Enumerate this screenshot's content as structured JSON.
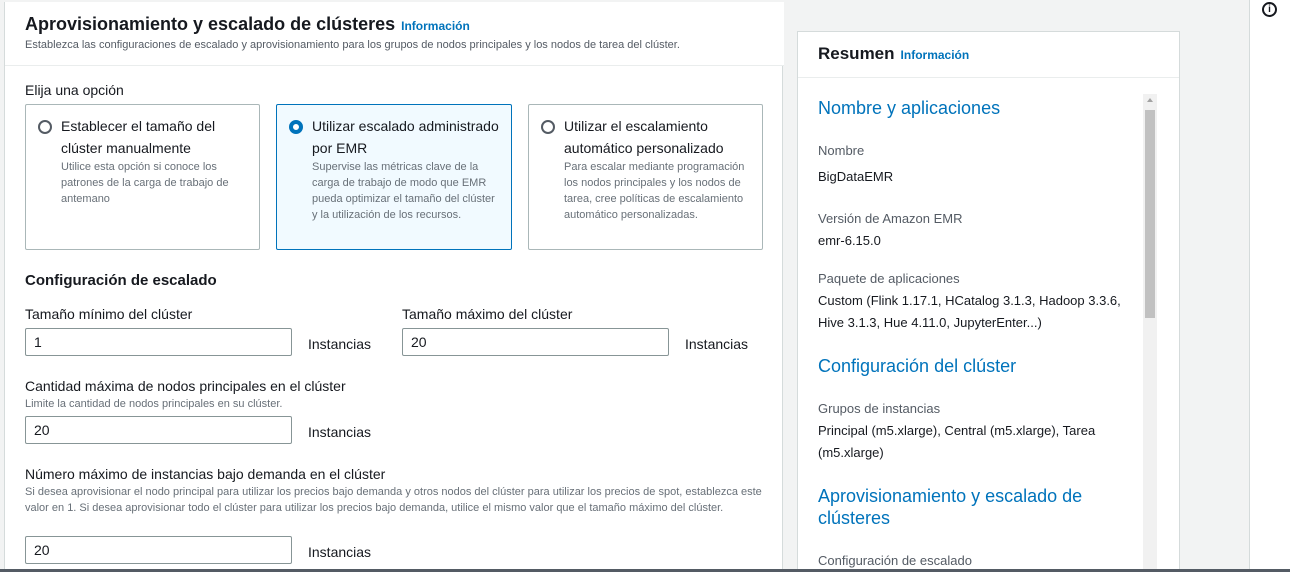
{
  "main": {
    "title": "Aprovisionamiento y escalado de clústeres",
    "info_link": "Información",
    "subtitle": "Establezca las configuraciones de escalado y aprovisionamiento para los grupos de nodos principales y los nodos de tarea del clúster.",
    "choose_label": "Elija una opción",
    "options": [
      {
        "title": "Establecer el tamaño del clúster manualmente",
        "desc": "Utilice esta opción si conoce los patrones de la carga de trabajo de antemano",
        "selected": false
      },
      {
        "title": "Utilizar escalado administrado por EMR",
        "desc": "Supervise las métricas clave de la carga de trabajo de modo que EMR pueda optimizar el tamaño del clúster y la utilización de los recursos.",
        "selected": true
      },
      {
        "title": "Utilizar el escalamiento automático personalizado",
        "desc": "Para escalar mediante programación los nodos principales y los nodos de tarea, cree políticas de escalamiento automático personalizadas.",
        "selected": false
      }
    ],
    "scaling_heading": "Configuración de escalado",
    "min_size_label": "Tamaño mínimo del clúster",
    "min_size_value": "1",
    "max_size_label": "Tamaño máximo del clúster",
    "max_size_value": "20",
    "instances_unit": "Instancias",
    "max_core_label": "Cantidad máxima de nodos principales en el clúster",
    "max_core_desc": "Limite la cantidad de nodos principales en su clúster.",
    "max_core_value": "20",
    "max_ondemand_label": "Número máximo de instancias bajo demanda en el clúster",
    "max_ondemand_desc": "Si desea aprovisionar el nodo principal para utilizar los precios bajo demanda y otros nodos del clúster para utilizar los precios de spot, establezca este valor en 1. Si desea aprovisionar todo el clúster para utilizar los precios bajo demanda, utilice el mismo valor que el tamaño máximo del clúster.",
    "max_ondemand_value": "20"
  },
  "summary": {
    "title": "Resumen",
    "info_link": "Información",
    "section1_heading": "Nombre y aplicaciones",
    "name_key": "Nombre",
    "name_value": "BigDataEMR",
    "version_key": "Versión de Amazon EMR",
    "version_value": "emr-6.15.0",
    "package_key": "Paquete de aplicaciones",
    "package_value": "Custom (Flink 1.17.1, HCatalog 3.1.3, Hadoop 3.3.6, Hive 3.1.3, Hue 4.11.0, JupyterEnter...)",
    "section2_heading": "Configuración del clúster",
    "groups_key": "Grupos de instancias",
    "groups_value": "Principal (m5.xlarge), Central (m5.xlarge), Tarea (m5.xlarge)",
    "section3_heading": "Aprovisionamiento y escalado de clústeres",
    "scaling_key": "Configuración de escalado"
  },
  "rail": {
    "icon": "info-icon"
  },
  "colors": {
    "accent": "#0073bb",
    "selected_bg": "#f1faff",
    "text": "#16191f",
    "muted": "#687078"
  }
}
